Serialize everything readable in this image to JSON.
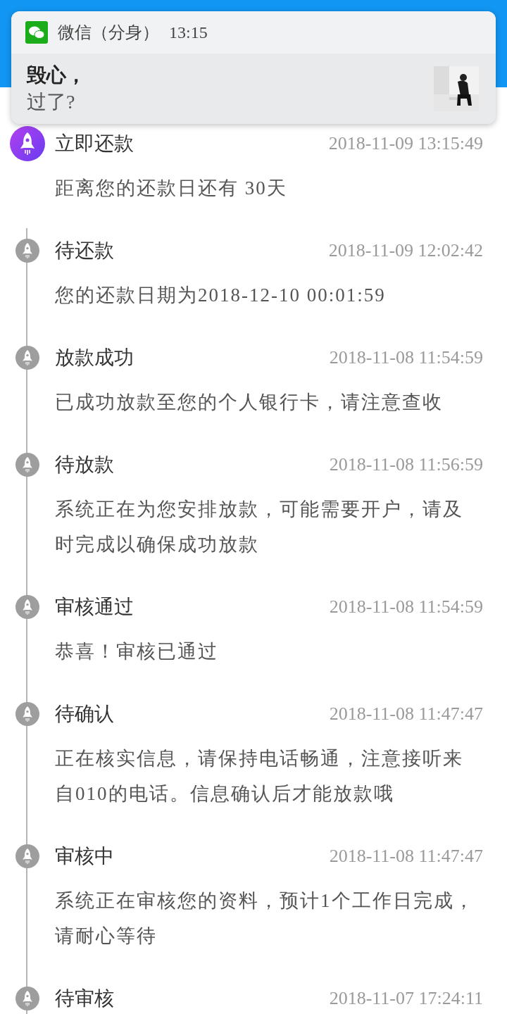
{
  "notification": {
    "app": "微信（分身）",
    "time": "13:15",
    "sender": "毁心，",
    "message": "过了?"
  },
  "timeline": [
    {
      "title": "立即还款",
      "time": "2018-11-09 13:15:49",
      "text": "距离您的还款日还有 30天",
      "current": true
    },
    {
      "title": "待还款",
      "time": "2018-11-09 12:02:42",
      "text": "您的还款日期为2018-12-10 00:01:59",
      "current": false
    },
    {
      "title": "放款成功",
      "time": "2018-11-08 11:54:59",
      "text": "已成功放款至您的个人银行卡，请注意查收",
      "current": false
    },
    {
      "title": "待放款",
      "time": "2018-11-08 11:56:59",
      "text": "系统正在为您安排放款，可能需要开户，请及时完成以确保成功放款",
      "current": false
    },
    {
      "title": "审核通过",
      "time": "2018-11-08 11:54:59",
      "text": "恭喜！审核已通过",
      "current": false
    },
    {
      "title": "待确认",
      "time": "2018-11-08 11:47:47",
      "text": "正在核实信息，请保持电话畅通，注意接听来自010的电话。信息确认后才能放款哦",
      "current": false
    },
    {
      "title": "审核中",
      "time": "2018-11-08 11:47:47",
      "text": "系统正在审核您的资料，预计1个工作日完成，请耐心等待",
      "current": false
    },
    {
      "title": "待审核",
      "time": "2018-11-07 17:24:11",
      "current": false
    }
  ]
}
